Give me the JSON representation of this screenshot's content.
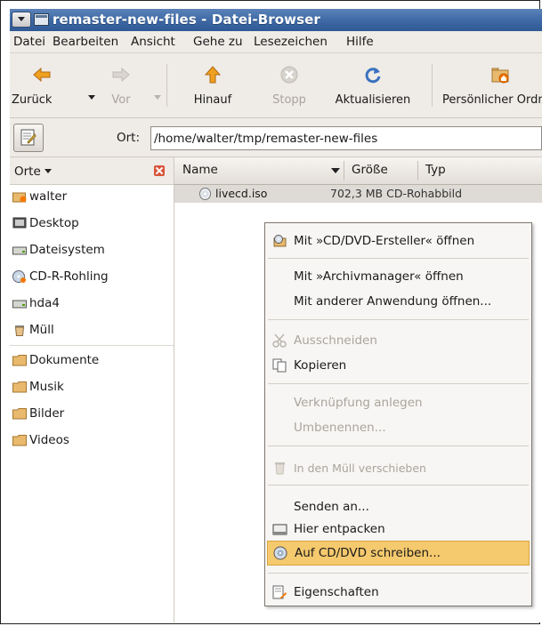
{
  "window": {
    "title": "remaster-new-files - Datei-Browser"
  },
  "menubar": [
    "Datei",
    "Bearbeiten",
    "Ansicht",
    "Gehe zu",
    "Lesezeichen",
    "Hilfe"
  ],
  "toolbar": {
    "back": "Zurück",
    "forward": "Vor",
    "up": "Hinauf",
    "stop": "Stopp",
    "reload": "Aktualisieren",
    "home": "Persönlicher Ordner"
  },
  "location": {
    "label": "Ort:",
    "path": "/home/walter/tmp/remaster-new-files"
  },
  "sidebar": {
    "header": "Orte",
    "places": [
      "walter",
      "Desktop",
      "Dateisystem",
      "CD-R-Rohling",
      "hda4",
      "Müll"
    ],
    "bookmarks": [
      "Dokumente",
      "Musik",
      "Bilder",
      "Videos"
    ]
  },
  "filelist": {
    "columns": [
      "Name",
      "Größe",
      "Typ"
    ],
    "files": [
      {
        "name": "livecd.iso",
        "rest": "702,3 MB  CD-Rohabbild"
      }
    ]
  },
  "context_menu": {
    "items": [
      {
        "label": "Mit »CD/DVD-Ersteller« öffnen",
        "enabled": true,
        "icon": "cd-creator-icon"
      },
      {
        "label": "Mit »Archivmanager« öffnen",
        "enabled": true,
        "icon": ""
      },
      {
        "label": "Mit anderer Anwendung öffnen...",
        "enabled": true,
        "icon": ""
      },
      {
        "label": "Ausschneiden",
        "enabled": false,
        "icon": "scissors-icon"
      },
      {
        "label": "Kopieren",
        "enabled": true,
        "icon": "copy-icon"
      },
      {
        "label": "Verknüpfung anlegen",
        "enabled": false,
        "icon": ""
      },
      {
        "label": "Umbenennen...",
        "enabled": false,
        "icon": ""
      },
      {
        "label": "In den Müll verschieben",
        "enabled": false,
        "icon": "trash-icon"
      },
      {
        "label": "Senden an...",
        "enabled": true,
        "icon": ""
      },
      {
        "label": "Hier entpacken",
        "enabled": true,
        "icon": "drive-icon"
      },
      {
        "label": "Auf CD/DVD schreiben...",
        "enabled": true,
        "highlighted": true,
        "icon": "burn-disc-icon"
      },
      {
        "label": "Eigenschaften",
        "enabled": true,
        "icon": "properties-icon"
      }
    ]
  },
  "colors": {
    "titlebar": "#3c68a4",
    "highlight": "#f5c96d",
    "window_bg": "#efebe7"
  }
}
